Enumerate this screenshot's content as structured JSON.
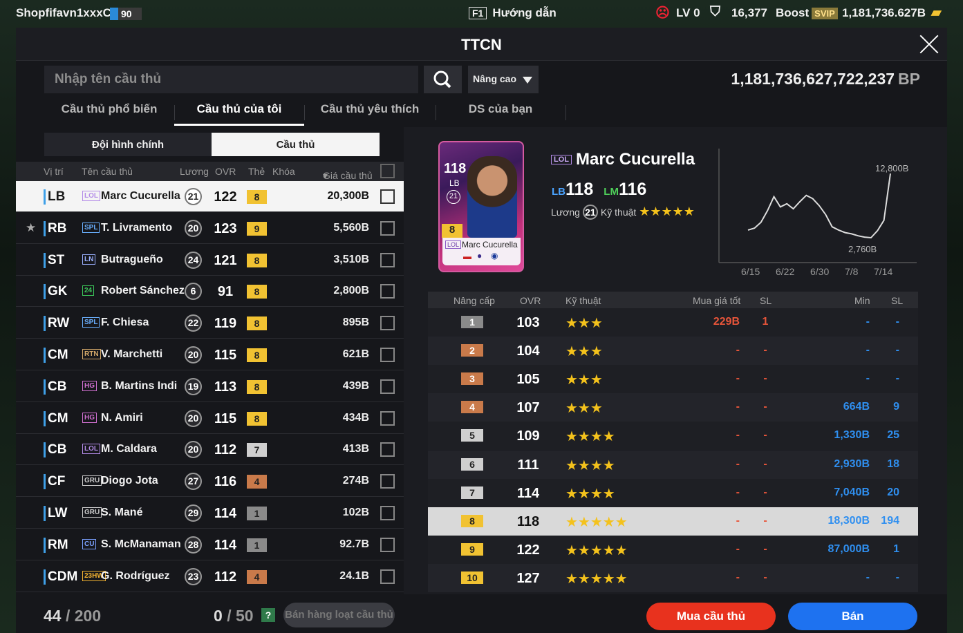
{
  "topbar": {
    "username": "Shopfifavn1xxxCh",
    "level_badge": "90",
    "help_key": "F1",
    "help_label": "Hướng dẫn",
    "lv": "LV 0",
    "trophies": "16,377",
    "boost": "Boost",
    "svip": "SVIP",
    "bp_short": "1,181,736.627B"
  },
  "window": {
    "title": "TTCN"
  },
  "search": {
    "placeholder": "Nhập tên cầu thủ",
    "advanced": "Nâng cao"
  },
  "bp": {
    "value": "1,181,736,627,722,237",
    "unit": "BP"
  },
  "tabs": [
    "Cầu thủ phổ biến",
    "Cầu thủ của tôi",
    "Cầu thủ yêu thích",
    "DS của bạn"
  ],
  "subtabs": [
    "Đội hình chính",
    "Cầu thủ"
  ],
  "list_headers": [
    "Vị trí",
    "Tên cầu thủ",
    "Lương",
    "OVR",
    "Thẻ",
    "Khóa",
    "Giá cầu thủ"
  ],
  "players": [
    {
      "pos": "LB",
      "season": "LOL",
      "name": "Marc Cucurella",
      "salary": "21",
      "ovr": "122",
      "level": "8",
      "price": "20,300B",
      "starred": ""
    },
    {
      "pos": "RB",
      "season": "SPL",
      "name": "T. Livramento",
      "salary": "20",
      "ovr": "123",
      "level": "9",
      "price": "5,560B",
      "starred": "★"
    },
    {
      "pos": "ST",
      "season": "LN",
      "name": "Butragueño",
      "salary": "24",
      "ovr": "121",
      "level": "8",
      "price": "3,510B",
      "starred": ""
    },
    {
      "pos": "GK",
      "season": "24",
      "name": "Robert Sánchez",
      "salary": "6",
      "ovr": "91",
      "level": "8",
      "price": "2,800B",
      "starred": ""
    },
    {
      "pos": "RW",
      "season": "SPL",
      "name": "F. Chiesa",
      "salary": "22",
      "ovr": "119",
      "level": "8",
      "price": "895B",
      "starred": ""
    },
    {
      "pos": "CM",
      "season": "RTN",
      "name": "V. Marchetti",
      "salary": "20",
      "ovr": "115",
      "level": "8",
      "price": "621B",
      "starred": ""
    },
    {
      "pos": "CB",
      "season": "HG",
      "name": "B. Martins Indi",
      "salary": "19",
      "ovr": "113",
      "level": "8",
      "price": "439B",
      "starred": ""
    },
    {
      "pos": "CM",
      "season": "HG",
      "name": "N. Amiri",
      "salary": "20",
      "ovr": "115",
      "level": "8",
      "price": "434B",
      "starred": ""
    },
    {
      "pos": "CB",
      "season": "LOL",
      "name": "M. Caldara",
      "salary": "20",
      "ovr": "112",
      "level": "7",
      "price": "413B",
      "starred": ""
    },
    {
      "pos": "CF",
      "season": "GRU",
      "name": "Diogo Jota",
      "salary": "27",
      "ovr": "116",
      "level": "4",
      "price": "274B",
      "starred": ""
    },
    {
      "pos": "LW",
      "season": "GRU",
      "name": "S. Mané",
      "salary": "29",
      "ovr": "114",
      "level": "1",
      "price": "102B",
      "starred": ""
    },
    {
      "pos": "RM",
      "season": "CU",
      "name": "S. McManaman",
      "salary": "28",
      "ovr": "114",
      "level": "1",
      "price": "92.7B",
      "starred": ""
    },
    {
      "pos": "CDM",
      "season": "23HW",
      "name": "G. Rodríguez",
      "salary": "23",
      "ovr": "112",
      "level": "4",
      "price": "24.1B",
      "starred": ""
    }
  ],
  "footer": {
    "count": "44",
    "count_max": "/ 200",
    "sel": "0",
    "sel_max": "/ 50",
    "help": "?",
    "bulk_sell": "Bán hàng loạt cầu thủ"
  },
  "detail": {
    "season": "LOL",
    "name": "Marc Cucurella",
    "pos1": "LB",
    "ovr1": "118",
    "pos2": "LM",
    "ovr2": "116",
    "salary_label": "Lương",
    "salary": "21",
    "skill_label": "Kỹ thuật",
    "skill_stars": "★★★★★",
    "card": {
      "ovr": "118",
      "pos": "LB",
      "salary": "21",
      "level": "8",
      "season": "LOL",
      "name": "Marc Cucurella"
    }
  },
  "chart_data": {
    "type": "line",
    "x": [
      "6/15",
      "6/22",
      "6/30",
      "7/8",
      "7/14"
    ],
    "max_label": "12,800B",
    "min_label": "2,760B",
    "values": [
      4.0,
      4.3,
      5.2,
      7.0,
      9.2,
      7.6,
      8.1,
      7.3,
      8.4,
      9.4,
      8.9,
      7.8,
      6.4,
      4.5,
      4.0,
      3.6,
      3.4,
      3.1,
      2.9,
      2.8,
      3.9,
      5.5,
      12.8
    ]
  },
  "upgrade_headers": [
    "Nâng cấp",
    "OVR",
    "Kỹ thuật",
    "Mua giá tốt",
    "SL",
    "Min",
    "SL"
  ],
  "upgrades": [
    {
      "lv": "1",
      "ovr": "103",
      "stars": "★★★",
      "buy": "229B",
      "bs": "1",
      "min": "-",
      "ms": "-"
    },
    {
      "lv": "2",
      "ovr": "104",
      "stars": "★★★",
      "buy": "-",
      "bs": "-",
      "min": "-",
      "ms": "-"
    },
    {
      "lv": "3",
      "ovr": "105",
      "stars": "★★★",
      "buy": "-",
      "bs": "-",
      "min": "-",
      "ms": "-"
    },
    {
      "lv": "4",
      "ovr": "107",
      "stars": "★★★",
      "buy": "-",
      "bs": "-",
      "min": "664B",
      "ms": "9"
    },
    {
      "lv": "5",
      "ovr": "109",
      "stars": "★★★★",
      "buy": "-",
      "bs": "-",
      "min": "1,330B",
      "ms": "25"
    },
    {
      "lv": "6",
      "ovr": "111",
      "stars": "★★★★",
      "buy": "-",
      "bs": "-",
      "min": "2,930B",
      "ms": "18"
    },
    {
      "lv": "7",
      "ovr": "114",
      "stars": "★★★★",
      "buy": "-",
      "bs": "-",
      "min": "7,040B",
      "ms": "20"
    },
    {
      "lv": "8",
      "ovr": "118",
      "stars": "★★★★★",
      "buy": "-",
      "bs": "-",
      "min": "18,300B",
      "ms": "194"
    },
    {
      "lv": "9",
      "ovr": "122",
      "stars": "★★★★★",
      "buy": "-",
      "bs": "-",
      "min": "87,000B",
      "ms": "1"
    },
    {
      "lv": "10",
      "ovr": "127",
      "stars": "★★★★★",
      "buy": "-",
      "bs": "-",
      "min": "-",
      "ms": "-"
    }
  ],
  "actions": {
    "buy": "Mua cầu thủ",
    "sell": "Bán"
  },
  "colors": {
    "lvl_colors": {
      "1": "#8a8a8a",
      "2": "#c97a4a",
      "3": "#c97a4a",
      "4": "#c97a4a",
      "5": "#cfcfcf",
      "6": "#cfcfcf",
      "7": "#cfcfcf",
      "8": "#f1c232",
      "9": "#f1c232",
      "10": "#f1c232"
    }
  }
}
